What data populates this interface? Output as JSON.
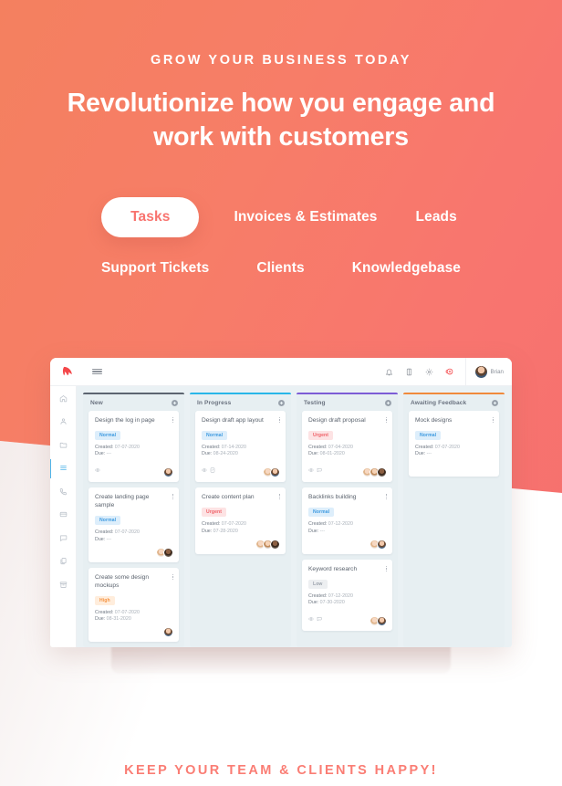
{
  "hero": {
    "eyebrow": "GROW YOUR BUSINESS TODAY",
    "headline": "Revolutionize how you engage and work with customers"
  },
  "tabs": {
    "row1": [
      {
        "label": "Tasks",
        "active": true
      },
      {
        "label": "Invoices & Estimates",
        "active": false
      },
      {
        "label": "Leads",
        "active": false
      }
    ],
    "row2": [
      {
        "label": "Support Tickets",
        "active": false
      },
      {
        "label": "Clients",
        "active": false
      },
      {
        "label": "Knowledgebase",
        "active": false
      }
    ]
  },
  "footer": {
    "tagline": "KEEP YOUR TEAM & CLIENTS HAPPY!"
  },
  "app": {
    "topbar": {
      "logo": "app-logo-icon",
      "menu": "hamburger-icon",
      "icons": [
        "bell-icon",
        "tablet-icon",
        "gear-icon",
        "add-circle-icon"
      ],
      "user_name": "Brian"
    },
    "sidebar": [
      {
        "icon": "home-icon",
        "active": false
      },
      {
        "icon": "user-icon",
        "active": false
      },
      {
        "icon": "folder-icon",
        "active": false
      },
      {
        "icon": "list-icon",
        "active": true
      },
      {
        "icon": "phone-icon",
        "active": false
      },
      {
        "icon": "card-icon",
        "active": false
      },
      {
        "icon": "chat-icon",
        "active": false
      },
      {
        "icon": "copy-icon",
        "active": false
      },
      {
        "icon": "archive-icon",
        "active": false
      }
    ],
    "board": {
      "labels": {
        "created": "Created:",
        "due": "Due:"
      },
      "columns": [
        {
          "title": "New",
          "accent": "#5c6470",
          "cards": [
            {
              "title": "Design the log in page",
              "priority": "Normal",
              "priority_class": "normal",
              "created": "07-07-2020",
              "due": "---",
              "icons": [
                "eye-icon"
              ],
              "avatars": [
                "av1"
              ]
            },
            {
              "title": "Create landing page sample",
              "priority": "Normal",
              "priority_class": "normal",
              "created": "07-07-2020",
              "due": "---",
              "icons": [],
              "avatars": [
                "av4",
                "av3"
              ]
            },
            {
              "title": "Create some design mockups",
              "priority": "High",
              "priority_class": "high",
              "created": "07-07-2020",
              "due": "08-31-2020",
              "icons": [],
              "avatars": [
                "av1"
              ]
            }
          ]
        },
        {
          "title": "In Progress",
          "accent": "#29b6e8",
          "cards": [
            {
              "title": "Design draft app layout",
              "priority": "Normal",
              "priority_class": "normal",
              "created": "07-14-2020",
              "due": "08-24-2020",
              "icons": [
                "eye-icon",
                "checklist-icon"
              ],
              "avatars": [
                "av4",
                "av1"
              ]
            },
            {
              "title": "Create content plan",
              "priority": "Urgent",
              "priority_class": "urgent",
              "created": "07-07-2020",
              "due": "07-28-2020",
              "icons": [],
              "avatars": [
                "av4",
                "av2",
                "av3"
              ]
            }
          ]
        },
        {
          "title": "Testing",
          "accent": "#7c5cd6",
          "cards": [
            {
              "title": "Design draft proposal",
              "priority": "Urgent",
              "priority_class": "urgent",
              "created": "07-04-2020",
              "due": "08-01-2020",
              "icons": [
                "eye-icon",
                "comment-icon"
              ],
              "avatars": [
                "av4",
                "av2",
                "av3"
              ]
            },
            {
              "title": "Backlinks building",
              "priority": "Normal",
              "priority_class": "normal",
              "created": "07-12-2020",
              "due": "---",
              "icons": [],
              "avatars": [
                "av4",
                "av1"
              ]
            },
            {
              "title": "Keyword research",
              "priority": "Low",
              "priority_class": "low",
              "created": "07-12-2020",
              "due": "07-30-2020",
              "icons": [
                "eye-icon",
                "comment-icon"
              ],
              "avatars": [
                "av4",
                "av1"
              ]
            }
          ]
        },
        {
          "title": "Awaiting Feedback",
          "accent": "#f08a3c",
          "cards": [
            {
              "title": "Mock designs",
              "priority": "Normal",
              "priority_class": "normal",
              "created": "07-07-2020",
              "due": "---",
              "icons": [],
              "avatars": []
            }
          ]
        }
      ]
    }
  },
  "colors": {
    "brand_coral": "#f8736e",
    "gradient_start": "#f4805f",
    "gradient_end": "#f56e6e",
    "footer_text": "#fa7d74"
  }
}
